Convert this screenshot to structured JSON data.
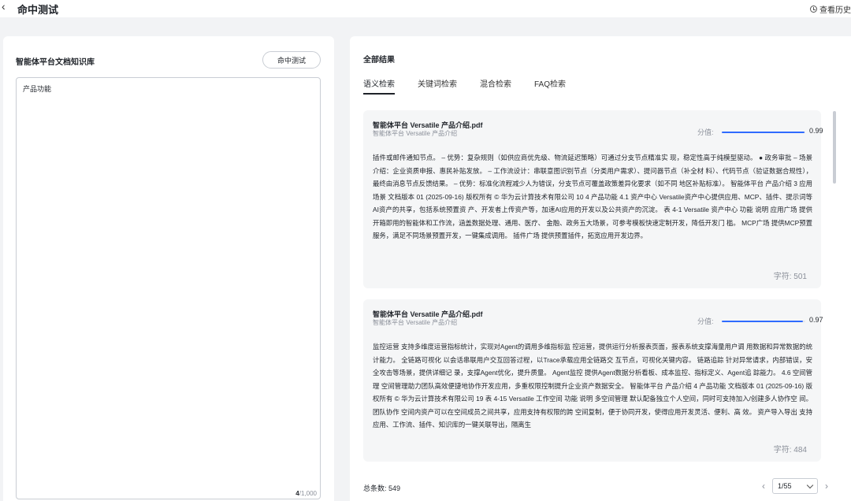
{
  "header": {
    "back_icon": "chevron-left-icon",
    "title": "命中测试",
    "history_icon": "clock-icon",
    "history_label": "查看历史"
  },
  "left": {
    "title": "智能体平台文档知识库",
    "hit_button": "命中测试",
    "query_value": "产品功能",
    "counter_current": "4",
    "counter_max": "/1,000"
  },
  "right": {
    "title": "全部结果",
    "tabs": [
      {
        "label": "语义检索",
        "active": true
      },
      {
        "label": "关键词检索",
        "active": false
      },
      {
        "label": "混合检索",
        "active": false
      },
      {
        "label": "FAQ检索",
        "active": false
      }
    ],
    "results": [
      {
        "doc_name": "智能体平台 Versatile 产品介绍.pdf",
        "doc_sub": "智能体平台 Versatile 产品介绍",
        "score_label": "分值:",
        "score": 0.99,
        "score_text": "0.99",
        "content": "插件或邮件通知节点。 – 优势：复杂规则（如供应商优先级、物流延迟策略）可通过分支节点精准实 现，稳定性高于纯模型驱动。 ● 政务审批 – 场景介绍：企业资质申报、惠民补贴发放。 – 工作流设计：串联意图识别节点（分类用户需求）、提问器节点（补全材 料）、代码节点（验证数据合规性），最终由消息节点反馈结果。 – 优势：标准化流程减少人为错误，分支节点可覆盖政策差异化要求（如不同 地区补贴标准）。 智能体平台 产品介绍 3 应用场景 文档版本 01 (2025-09-16) 版权所有 © 华为云计算技术有限公司 10 4 产品功能 4.1 资产中心 Versatile资产中心提供应用、MCP、插件、提示词等AI资产的共享，包括系统预置资 产、开发者上传资产等，加速AI应用的开发以及公共资产的沉淀。 表 4-1 Versatile 资产中心 功能 说明 应用广场 提供开箱即用的智能体和工作流，涵盖数据处理、通用、医疗、 金融、政务五大场景，可参考模板快速定制开发，降低开发门 槛。 MCP广场 提供MCP预置服务，满足不同场景预置开发，一键集成调用。 插件广场 提供预置插件，拓宽应用开发边界。",
        "chars": "字符: 501"
      },
      {
        "doc_name": "智能体平台 Versatile 产品介绍.pdf",
        "doc_sub": "智能体平台 Versatile 产品介绍",
        "score_label": "分值:",
        "score": 0.97,
        "score_text": "0.97",
        "content": "监控运营 支持多维度运营指标统计，实现对Agent的调用多维指标监 控运营，提供运行分析报表页面，报表系统支撑海量用户调 用数据和异常数据的统计能力。 全链路可视化 以会话串联用户交互回答过程，以Trace承载应用全链路交 互节点，可视化关键内容。 链路追踪 针对异常请求，内部错误，安全攻击等场景，提供详细记 录，支撑Agent优化，提升质量。 Agent监控 提供Agent数据分析看板、成本监控、指标定义、Agent追 踪能力。 4.6 空间管理 空间管理助力团队高效便捷地协作开发应用，多重权限控制提升企业资产数据安全。 智能体平台 产品介绍 4 产品功能 文档版本 01 (2025-09-16) 版权所有 © 华为云计算技术有限公司 19 表 4-15 Versatile 工作空间 功能 说明 多空间管理 默认配备独立个人空间，同时可支持加入/创建多人协作空 间。 团队协作 空间内资产可以在空间成员之间共享，应用支持有权限的跨 空间复制，便于协同开发，使得应用开发灵活、便利、高 效。 资产导入导出 支持应用、工作流、插件、知识库的一键关联导出，隔离生",
        "chars": "字符: 484"
      }
    ],
    "total_label": "总条数: 549",
    "pagination": {
      "prev_icon": "chevron-left-icon",
      "page_select": "1/55",
      "next_icon": "chevron-right-icon"
    }
  }
}
